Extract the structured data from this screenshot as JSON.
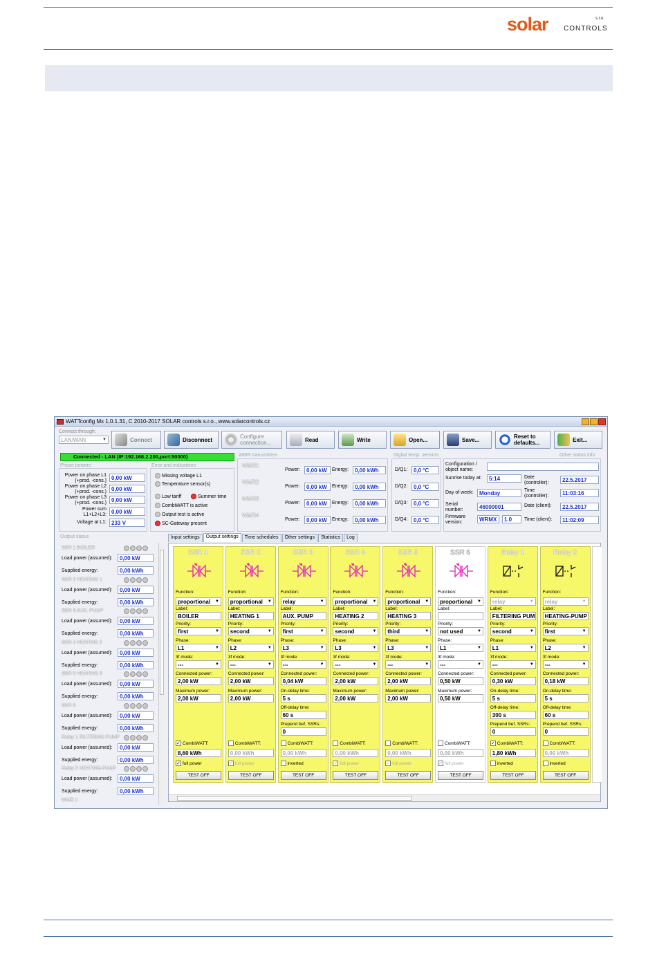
{
  "brand": {
    "solar": "solar",
    "controls": "CONTROLS",
    "sro": "s.r.o."
  },
  "window": {
    "title": "WATTconfig Mx 1.0.1.31, C 2010-2017 SOLAR controls s.r.o., www.solarcontrols.cz",
    "conn_mode_label": "Connect through:",
    "conn_mode_value": "LAN/WAN",
    "toolbar": {
      "connect": "Connect",
      "disconnect": "Disconnect",
      "configure": "Configure connection...",
      "read": "Read",
      "write": "Write",
      "open": "Open...",
      "save": "Save...",
      "reset": "Reset to defaults...",
      "exit": "Exit..."
    },
    "status_text": "Connected - LAN (IP:192.168.2.200,port:50000)",
    "phase_powers": {
      "title": "Phase powers",
      "l1_label": "Power on phase L1 (+prod. -cons.)",
      "l1": "0,00 kW",
      "l2_label": "Power on phase L2 (+prod. -cons.)",
      "l2": "0,00 kW",
      "l3_label": "Power on phase L3 (+prod. -cons.)",
      "l3": "0,00 kW",
      "sum_label": "Power sum L1+L2+L3:",
      "sum": "0,00 kW",
      "volt_label": "Voltage at L1:",
      "volt": "233 V"
    },
    "errors": {
      "title": "Error and indications",
      "items": [
        "Missing voltage L1",
        "Temperature sensor(s)",
        "Low tariff",
        "Summer time",
        "CombiWATT is active",
        "Output test is active",
        "SC-Gateway present"
      ]
    },
    "wmr": {
      "title": "WMR transmitters",
      "rows": [
        {
          "name": "WMR1",
          "power_label": "Power:",
          "power": "0,00 kW",
          "energy_label": "Energy:",
          "energy": "0,00 kWh"
        },
        {
          "name": "WMR2",
          "power_label": "Power:",
          "power": "0,00 kW",
          "energy_label": "Energy:",
          "energy": "0,00 kWh"
        },
        {
          "name": "WMR3",
          "power_label": "Power:",
          "power": "0,00 kW",
          "energy_label": "Energy:",
          "energy": "0,00 kWh"
        },
        {
          "name": "WMR4",
          "power_label": "Power:",
          "power": "0,00 kW",
          "energy_label": "Energy:",
          "energy": "0,00 kWh"
        }
      ]
    },
    "temps": {
      "title": "Digital temp. sensors",
      "rows": [
        {
          "label": "D/Q1:",
          "value": "0,0 °C"
        },
        {
          "label": "D/Q2:",
          "value": "0,0 °C"
        },
        {
          "label": "D/Q3:",
          "value": "0,0 °C"
        },
        {
          "label": "D/Q4:",
          "value": "0,0 °C"
        }
      ]
    },
    "other": {
      "title": "Other status info",
      "config_label": "Configuration / object name:",
      "config_value": "",
      "sunrise_label": "Sunrise today at:",
      "sunrise": "5:14",
      "dow_label": "Day of week:",
      "dow": "Monday",
      "serial_label": "Serial number:",
      "serial": "46000001",
      "fw_label": "Firmware version:",
      "fw1": "WRMX",
      "fw2": "1.0",
      "date_ctrl_label": "Date (controller):",
      "date_ctrl": "22.5.2017",
      "time_ctrl_label": "Time (controller):",
      "time_ctrl": "11:03:16",
      "date_client_label": "Date (client):",
      "date_client": "22.5.2017",
      "time_client_label": "Time (client):",
      "time_client": "11:02:09"
    },
    "output_status": {
      "title": "Output status",
      "load_label": "Load power (assumed):",
      "supplied_label": "Supplied energy:",
      "items": [
        {
          "name": "SSR 1 BOILER",
          "load": "0,00 kW",
          "supplied": "0,00 kWh"
        },
        {
          "name": "SSR 2 HEATING 1",
          "load": "0,00 kW",
          "supplied": "0,00 kWh"
        },
        {
          "name": "SSR 3 AUX. PUMP",
          "load": "0,00 kW",
          "supplied": "0,00 kWh"
        },
        {
          "name": "SSR 4 HEATING 2",
          "load": "0,00 kW",
          "supplied": "0,00 kWh"
        },
        {
          "name": "SSR 5 HEATING 3",
          "load": "0,00 kW",
          "supplied": "0,00 kWh"
        },
        {
          "name": "SSR 6",
          "load": "0,00 kW",
          "supplied": "0,00 kWh"
        },
        {
          "name": "Relay 1 FILTERING PUMP",
          "load": "0,00 kW",
          "supplied": "0,00 kWh"
        },
        {
          "name": "Relay 2 HEATING-PUMP",
          "load": "0,00 kW",
          "supplied": "0,00 kWh"
        }
      ],
      "last": "WMR 1"
    },
    "tabs": [
      "Input settings",
      "Output settings",
      "Time schedules",
      "Other settings",
      "Statistics",
      "Log"
    ],
    "labels": {
      "function": "Function:",
      "label": "Label:",
      "priority": "Priority:",
      "phase": "Phase:",
      "mode3f": "3f mode:",
      "conn_power": "Connected power:",
      "max_power": "Maximum power:",
      "on_delay": "On-delay time:",
      "off_delay": "Off-delay time:",
      "prepend": "Prepend bef. SSRs:",
      "combiwatt": "CombiWATT:",
      "full_power": "full power",
      "inverted": "inverted",
      "test_off": "TEST OFF"
    },
    "outputs": [
      {
        "name": "SSR 1",
        "function": "proportional",
        "label": "BOILER",
        "priority": "first",
        "phase": "L1",
        "mode3f": "---",
        "conn_power": "2,00 kW",
        "f2": "2,00 kW",
        "f3": "",
        "f4": "",
        "combi": "8,60 kWh",
        "combi_on": "✓",
        "opt": "full power",
        "opt_on": "✓"
      },
      {
        "name": "SSR 2",
        "function": "proportional",
        "label": "HEATING 1",
        "priority": "second",
        "phase": "L2",
        "mode3f": "---",
        "conn_power": "2,00 kW",
        "f2": "2,00 kW",
        "f3": "",
        "f4": "",
        "combi": "0,00 kWh",
        "combi_on": "",
        "opt": "full power",
        "opt_on": "✓"
      },
      {
        "name": "SSR 3",
        "function": "relay",
        "label": "AUX. PUMP",
        "priority": "first",
        "phase": "L3",
        "mode3f": "---",
        "conn_power": "0,04 kW",
        "f2": "5 s",
        "f3": "60 s",
        "f4": "0",
        "combi": "0,00 kWh",
        "combi_on": "",
        "opt": "inverted",
        "opt_on": ""
      },
      {
        "name": "SSR 4",
        "function": "proportional",
        "label": "HEATING 2",
        "priority": "second",
        "phase": "L3",
        "mode3f": "---",
        "conn_power": "2,00 kW",
        "f2": "2,00 kW",
        "f3": "",
        "f4": "",
        "combi": "0,00 kWh",
        "combi_on": "",
        "opt": "full power",
        "opt_on": "✓"
      },
      {
        "name": "SSR 5",
        "function": "proportional",
        "label": "HEATING 3",
        "priority": "third",
        "phase": "L3",
        "mode3f": "---",
        "conn_power": "2,00 kW",
        "f2": "2,00 kW",
        "f3": "",
        "f4": "",
        "combi": "0,00 kWh",
        "combi_on": "",
        "opt": "full power",
        "opt_on": "✓"
      },
      {
        "name": "SSR 6",
        "function": "proportional",
        "label": "",
        "priority": "not used",
        "phase": "L1",
        "mode3f": "---",
        "conn_power": "0,50 kW",
        "f2": "0,50 kW",
        "f3": "",
        "f4": "",
        "combi": "0,00 kWh",
        "combi_on": "",
        "opt": "full power",
        "opt_on": "✓"
      },
      {
        "name": "Relay 1",
        "function": "relay",
        "label": "FILTERING PUM",
        "priority": "second",
        "phase": "L1",
        "mode3f": "---",
        "conn_power": "0,30 kW",
        "f2": "5 s",
        "f3": "300 s",
        "f4": "0",
        "combi": "1,80 kWh",
        "combi_on": "✓",
        "opt": "inverted",
        "opt_on": ""
      },
      {
        "name": "Relay 2",
        "function": "relay",
        "label": "HEATING-PUMP",
        "priority": "first",
        "phase": "L2",
        "mode3f": "---",
        "conn_power": "0,18 kW",
        "f2": "5 s",
        "f3": "60 s",
        "f4": "0",
        "combi": "0,00 kWh",
        "combi_on": "",
        "opt": "inverted",
        "opt_on": ""
      }
    ]
  }
}
